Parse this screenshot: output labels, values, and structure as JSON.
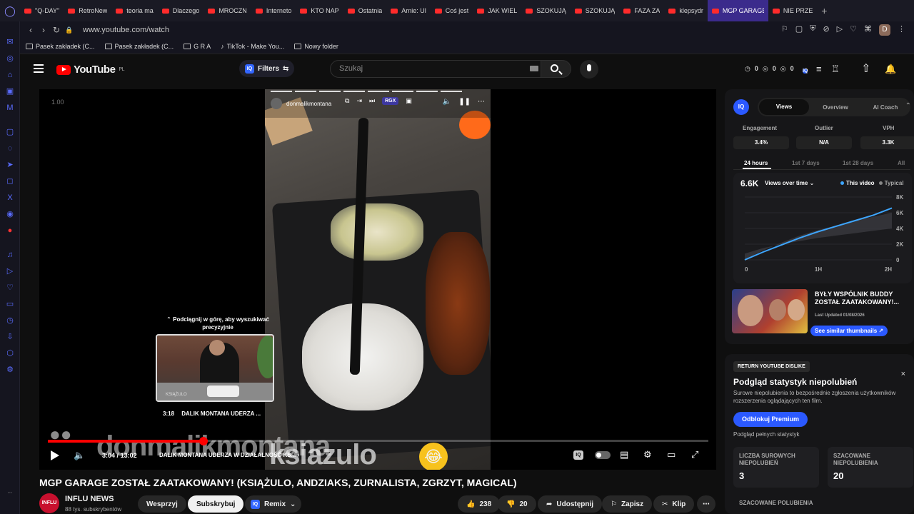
{
  "browser": {
    "tabs": [
      {
        "label": "\"Q-DAY\""
      },
      {
        "label": "RetroNew"
      },
      {
        "label": "teoria ma"
      },
      {
        "label": "Dlaczego"
      },
      {
        "label": "MROCZN"
      },
      {
        "label": "Interneto"
      },
      {
        "label": "KTO NAP"
      },
      {
        "label": "Ostatnia"
      },
      {
        "label": "Arnie: Ul"
      },
      {
        "label": "Coś jest"
      },
      {
        "label": "JAK WIEL"
      },
      {
        "label": "SZOKUJĄ"
      },
      {
        "label": "SZOKUJĄ"
      },
      {
        "label": "FAZA ZA"
      },
      {
        "label": "klepsydr"
      },
      {
        "label": "MGP GARAGE ZO",
        "active": true
      },
      {
        "label": "NIE PRZE"
      }
    ],
    "url": "www.youtube.com/watch",
    "profile_initial": "D",
    "bookmarks": [
      {
        "label": "Pasek zakładek (C..."
      },
      {
        "label": "Pasek zakładek (C..."
      },
      {
        "label": "G R A"
      },
      {
        "label": "TikTok - Make You..."
      },
      {
        "label": "Nowy folder"
      }
    ]
  },
  "header": {
    "logo": "YouTube",
    "region": "PL",
    "filters_label": "Filters",
    "search_placeholder": "Szukaj",
    "stats": [
      "0",
      "0",
      "0"
    ]
  },
  "player": {
    "speed": "1.00",
    "ig_username": "donmalikmontana",
    "ig_badge": "RGX",
    "seek_hint": "Podciągnij w górę, aby wyszukiwać precyzyjnie",
    "preview_time": "3:18",
    "preview_title": "DALIK MONTANA UDERZA ...",
    "preview_logo": "KSIĄŻULO",
    "watermark_top": "donmalikmontana",
    "watermark_bottom": "ksiazulo",
    "current_time": "3:04",
    "duration": "13:02",
    "time_separator": "/",
    "chapter_title": "DALIK MONTANA UDERZA W DZIAŁALNOŚĆ KS...",
    "progress_fraction": 0.236
  },
  "video": {
    "title": "MGP GARAGE ZOSTAŁ ZAATAKOWANY! (KSIĄŻULO, ANDZIAKS, ZURNALISTA, ZGRZYT, MAGICAL)",
    "channel_name": "INFLU NEWS",
    "channel_avatar_text": "INFLU",
    "subscribers": "88 tys. subskrybentów",
    "support_label": "Wesprzyj",
    "subscribe_label": "Subskrybuj",
    "remix_label": "Remix",
    "likes": "238",
    "dislikes": "20",
    "share_label": "Udostępnij",
    "save_label": "Zapisz",
    "clip_label": "Klip"
  },
  "analytics": {
    "iq_label": "IQ",
    "tabs": [
      "Views",
      "Overview",
      "AI Coach"
    ],
    "active_tab": "Views",
    "metrics": [
      {
        "label": "Engagement",
        "value": "3.4%"
      },
      {
        "label": "Outlier",
        "value": "N/A"
      },
      {
        "label": "VPH",
        "value": "3.3K"
      }
    ],
    "periods": [
      "24 hours",
      "1st 7 days",
      "1st 28 days",
      "All"
    ],
    "active_period": "24 hours",
    "chart_total": "6.6K",
    "chart_metric": "Views over time",
    "legend": [
      "This video",
      "Typical"
    ],
    "thumbnail_title": "BYŁY WSPÓLNIK BUDDY ZOSTAŁ ZAATAKOWANY!...",
    "thumbnail_date": "Last Updated 01/08/2026",
    "thumbnail_button": "See similar thumbnails"
  },
  "chart_data": {
    "type": "line",
    "x_ticks": [
      "0",
      "1H",
      "2H"
    ],
    "y_ticks": [
      "8K",
      "6K",
      "4K",
      "2K",
      "0"
    ],
    "ylim": [
      0,
      8000
    ],
    "x": [
      0,
      0.25,
      0.5,
      0.75,
      1.0,
      1.25,
      1.5,
      1.75,
      2.0
    ],
    "series": [
      {
        "name": "This video",
        "values": [
          0,
          1000,
          1900,
          2800,
          3600,
          4300,
          5000,
          5700,
          6600
        ],
        "color": "#3ea6ff"
      },
      {
        "name": "Typical",
        "values": [
          0,
          1200,
          2200,
          3100,
          3800,
          4400,
          5000,
          5500,
          6000
        ],
        "band": [
          800,
          1500,
          2000,
          2400,
          2800,
          3100,
          3400,
          3700,
          4000
        ],
        "color": "#888888"
      }
    ]
  },
  "dislikes_panel": {
    "tag": "RETURN YOUTUBE DISLIKE",
    "title": "Podgląd statystyk niepolubień",
    "description": "Surowe niepolubienia to bezpośrednie zgłoszenia użytkowników rozszerzenia oglądających ten film.",
    "unlock_label": "Odblokuj Premium",
    "full_stats": "Podgląd pełnych statystyk",
    "boxes": [
      {
        "label": "LICZBA SUROWYCH NIEPOLUBIEŃ",
        "value": "3"
      },
      {
        "label": "SZACOWANE NIEPOLUBIENIA",
        "value": "20"
      }
    ],
    "estimated_likes_label": "SZACOWANE POLUBIENIA"
  },
  "colors": {
    "accent": "#2b59ff",
    "yt_red": "#ff0000",
    "background": "#0f0f0f"
  }
}
